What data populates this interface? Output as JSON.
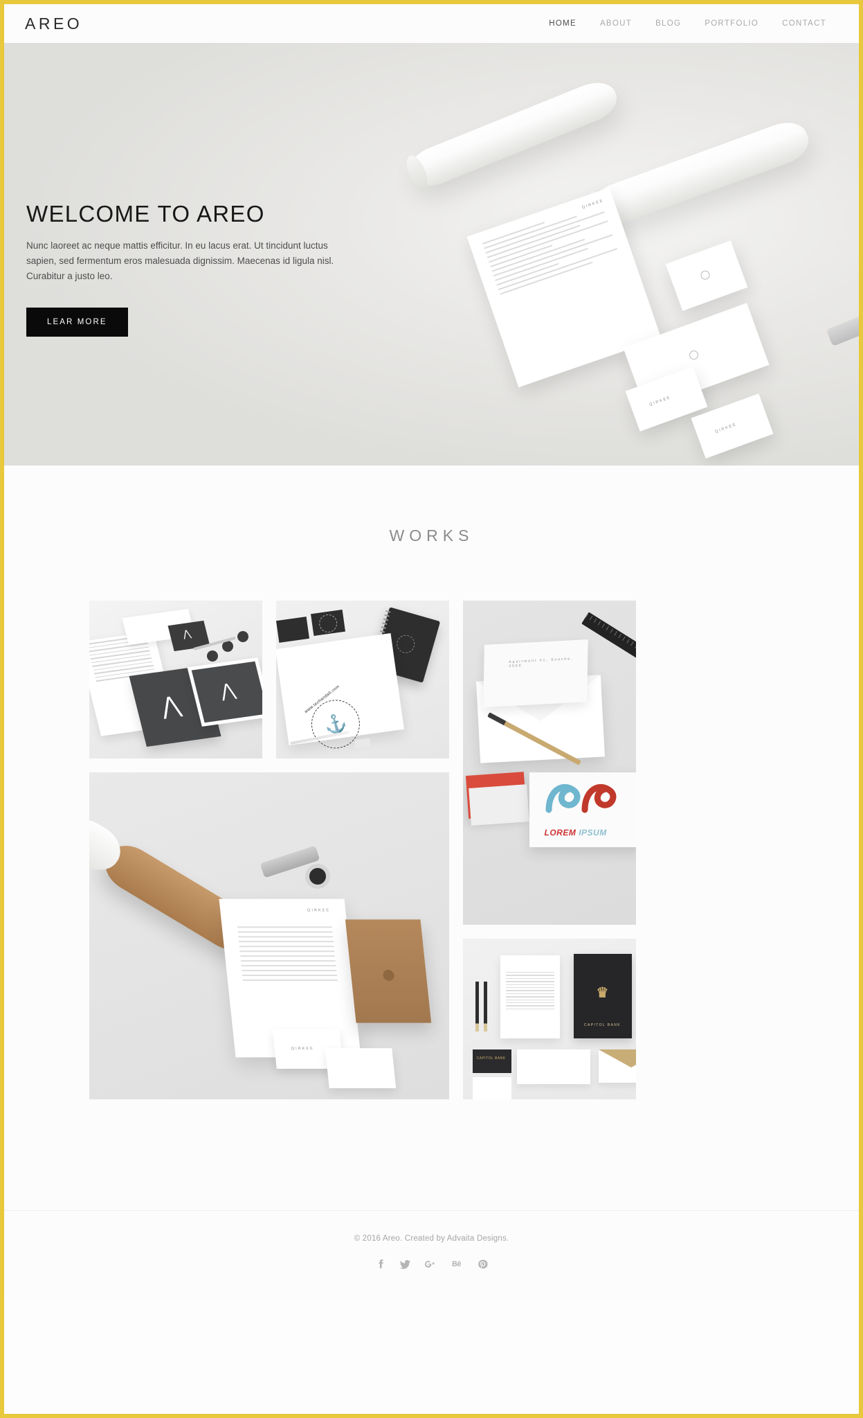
{
  "site": {
    "accent_color": "#e8c83c",
    "logo": "AREO"
  },
  "header": {
    "nav": [
      {
        "label": "HOME",
        "active": true
      },
      {
        "label": "ABOUT",
        "active": false
      },
      {
        "label": "BLOG",
        "active": false
      },
      {
        "label": "PORTFOLIO",
        "active": false
      },
      {
        "label": "CONTACT",
        "active": false
      }
    ]
  },
  "hero": {
    "title": "WELCOME TO AREO",
    "paragraph": "Nunc laoreet ac neque mattis efficitur. In eu lacus erat. Ut tincidunt luctus sapien, sed fermentum eros malesuada dignissim. Maecenas id ligula nisl. Curabitur a justo leo.",
    "button_label": "LEAR MORE",
    "image_alt": "White rolled poster tubes with letterhead, envelope and business cards stationery mockup",
    "stationery_brand": "QIRKEE"
  },
  "works": {
    "heading": "WORKS",
    "items": [
      {
        "id": "work-1",
        "alt": "Dark grey and white branding stationery with tablet mockup"
      },
      {
        "id": "work-2",
        "alt": "Anchor stamp logo letterhead with black spiral notebook",
        "logo_text": "www.techandall.com"
      },
      {
        "id": "work-3",
        "alt": "White envelope with black ruler, pencil and colourful logo card",
        "logo_text": "LOREM IPSUM",
        "logo_text_primary": "LOREM",
        "logo_text_secondary": "IPSUM"
      },
      {
        "id": "work-4",
        "alt": "Kraft paper tube, letterhead, kraft envelope and business cards"
      },
      {
        "id": "work-5",
        "alt": "Capitol Bank gold and black stationery set with pencils",
        "brand": "CAPITOL BANK"
      }
    ]
  },
  "footer": {
    "copyright": "© 2016 Areo. Created by Advaita Designs.",
    "social": [
      {
        "name": "facebook",
        "glyph": "f"
      },
      {
        "name": "twitter",
        "glyph": ""
      },
      {
        "name": "google-plus",
        "glyph": ""
      },
      {
        "name": "behance",
        "glyph": "Bē"
      },
      {
        "name": "pinterest",
        "glyph": ""
      }
    ]
  }
}
